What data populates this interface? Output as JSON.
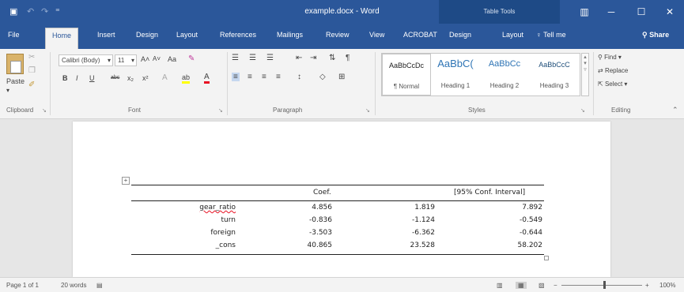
{
  "titlebar": {
    "title": "example.docx - Word",
    "contextual_group": "Table Tools",
    "save_icon": "▣",
    "undo_icon": "↶",
    "redo_icon": "↷",
    "qa_more": "⁼",
    "ribbon_display_icon": "▥",
    "minimize": "─",
    "maximize": "☐",
    "close": "✕"
  },
  "tabs": [
    "File",
    "Home",
    "Insert",
    "Design",
    "Layout",
    "References",
    "Mailings",
    "Review",
    "View",
    "ACROBAT",
    "Design",
    "Layout"
  ],
  "tell_me": "Tell me",
  "share": "Share",
  "ribbon": {
    "clipboard": {
      "label": "Clipboard",
      "paste": "Paste"
    },
    "font": {
      "label": "Font",
      "family": "Calibri (Body)",
      "size": "11",
      "grow": "A˄",
      "shrink": "A˅",
      "case": "Aa",
      "clear": "✎",
      "bold": "B",
      "italic": "I",
      "underline": "U",
      "strike": "abc",
      "subscript": "x₂",
      "superscript": "x²",
      "effects": "A",
      "highlight": "ab",
      "font_color": "A"
    },
    "paragraph": {
      "label": "Paragraph",
      "bullets": "☰",
      "numbering": "☰",
      "multilevel": "☰",
      "decrease_indent": "⇤",
      "increase_indent": "⇥",
      "sort": "⇅",
      "pilcrow": "¶",
      "align_left": "≡",
      "align_center": "≡",
      "align_right": "≡",
      "justify": "≡",
      "line_spacing": "↕",
      "shading": "◇",
      "borders": "⊞"
    },
    "styles": {
      "label": "Styles",
      "items": [
        {
          "sample": "AaBbCcDc",
          "name": "¶ Normal"
        },
        {
          "sample": "AaBbC(",
          "name": "Heading 1"
        },
        {
          "sample": "AaBbCc",
          "name": "Heading 2"
        },
        {
          "sample": "AaBbCcC",
          "name": "Heading 3"
        }
      ]
    },
    "editing": {
      "label": "Editing",
      "find": "Find",
      "replace": "Replace",
      "select": "Select"
    }
  },
  "table": {
    "headers": [
      "",
      "Coef.",
      "",
      "[95% Conf. Interval]"
    ],
    "rows": [
      [
        "gear_ratio",
        "4.856",
        "1.819",
        "7.892"
      ],
      [
        "turn",
        "-0.836",
        "-1.124",
        "-0.549"
      ],
      [
        "foreign",
        "-3.503",
        "-6.362",
        "-0.644"
      ],
      [
        "_cons",
        "40.865",
        "23.528",
        "58.202"
      ]
    ]
  },
  "status": {
    "page": "Page 1 of 1",
    "words": "20 words",
    "zoom": "100%",
    "zoom_minus": "−",
    "zoom_plus": "+"
  },
  "colors": {
    "accent": "#2b579a",
    "spell_error": "#e81123"
  }
}
